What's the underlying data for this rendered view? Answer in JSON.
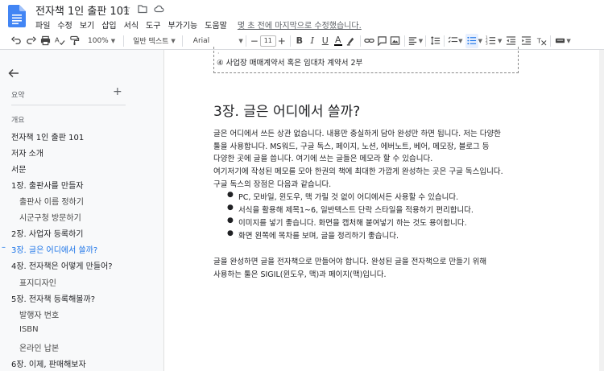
{
  "doc": {
    "title": "전자책 1인 출판 101",
    "last_edit": "몇 초 전에 마지막으로 수정했습니다."
  },
  "menu": [
    "파일",
    "수정",
    "보기",
    "삽입",
    "서식",
    "도구",
    "부가기능",
    "도움말"
  ],
  "toolbar": {
    "zoom": "100%",
    "style": "일반 텍스트",
    "font": "Arial",
    "font_size": "11",
    "minus": "−",
    "plus": "+"
  },
  "sidebar": {
    "summary_label": "요약",
    "summary_add": "+",
    "overview_label": "개요",
    "items": [
      {
        "label": "전자책 1인 출판 101",
        "level": 1
      },
      {
        "label": "저자 소개",
        "level": 1
      },
      {
        "label": "서문",
        "level": 1
      },
      {
        "label": "1장. 출판사를 만들자",
        "level": 1
      },
      {
        "label": "출판사 이름 정하기",
        "level": 2
      },
      {
        "label": "시군구청 방문하기",
        "level": 2
      },
      {
        "label": "2장. 사업자 등록하기",
        "level": 1
      },
      {
        "label": "3장. 글은 어디에서 쓸까?",
        "level": 1,
        "active": true
      },
      {
        "label": "4장. 전자책은 어떻게 만들어?",
        "level": 1
      },
      {
        "label": "표지디자인",
        "level": 2
      },
      {
        "label": "5장. 전자책 등록해볼까?",
        "level": 1
      },
      {
        "label": "발행자 번호",
        "level": 2
      },
      {
        "label": "ISBN",
        "level": 2
      },
      {
        "label": "온라인 납본",
        "level": 2
      },
      {
        "label": "6장. 이제, 판매해보자",
        "level": 1
      }
    ]
  },
  "page": {
    "boxed_item": "④ 사업장 매매계약서 혹은 임대차 계약서 2부",
    "heading": "3장. 글은 어디에서 쓸까?",
    "paragraph1": [
      "글은 어디에서 쓰든 상관 없습니다. 내용만 충실하게 담아 완성만 하면 됩니다. 저는 다양한",
      "툴을 사용합니다. MS워드, 구글 독스, 페이지, 노션, 에버노트, 베어, 메모장, 블로그 등",
      "다양한 곳에 글을 씁니다. 여기에 쓰는 글들은 메모라 할 수 있습니다.",
      "여기저기에 작성된 메모를 모아 한권의 책에 최대한 가깝게 완성하는 곳은 구글 독스입니다.",
      "구글 독스의 장점은 다음과 같습니다."
    ],
    "bullets": [
      "PC, 모바일, 윈도우, 맥 가릴 것 없이 어디에서든 사용할 수 있습니다.",
      "서식을 활용해 제목1~6, 일반텍스트 단락 스타일을 적용하기 편리합니다.",
      "이미지를 넣기 좋습니다. 화면을 캡처해 붙여넣기 하는 것도 용이합니다.",
      "화면 왼쪽에 목차를 보며, 글을 정리하기 좋습니다."
    ],
    "paragraph2": [
      "글을 완성하면 글을 전자책으로 만들어야 합니다. 완성된 글을 전자책으로 만들기 위해",
      "사용하는 툴은 SIGIL(윈도우, 맥)과 페이지(맥)입니다."
    ]
  },
  "colors": {
    "accent": "#1a73e8",
    "docs_blue": "#4285f4"
  }
}
